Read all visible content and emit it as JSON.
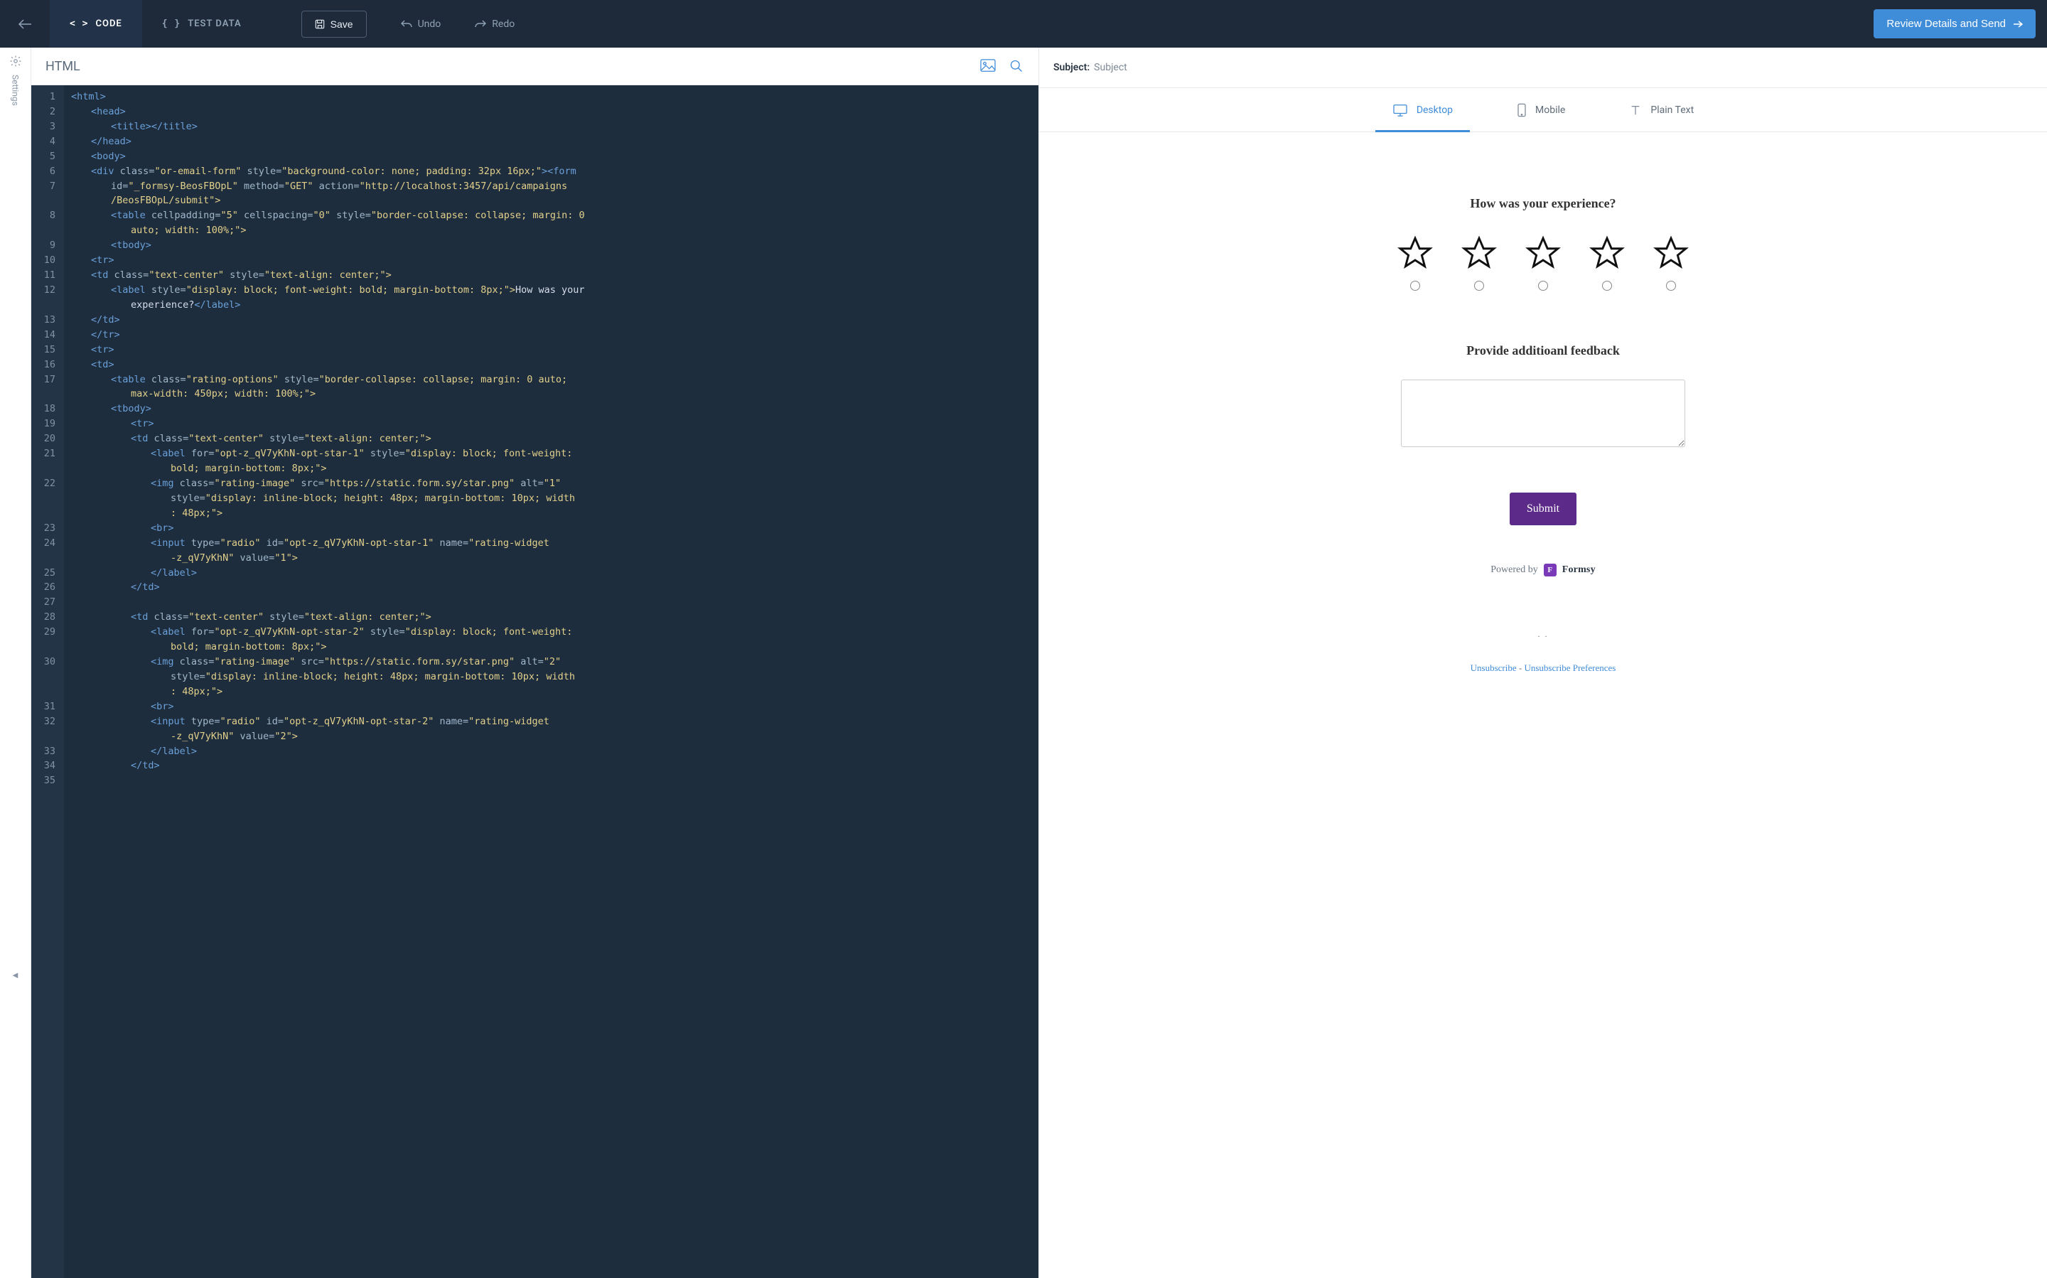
{
  "topbar": {
    "tabs": {
      "code": "CODE",
      "testdata": "TEST DATA"
    },
    "save": "Save",
    "undo": "Undo",
    "redo": "Redo",
    "review": "Review Details and Send"
  },
  "sidebar": {
    "settings": "Settings"
  },
  "editor": {
    "title": "HTML"
  },
  "code_lines": {
    "l1": "<html>",
    "l2": "<head>",
    "l3": "<title></title>",
    "l4": "</head>",
    "l5": "<body>",
    "l6_a": "<div",
    "l6_b": "class=",
    "l6_c": "\"or-email-form\"",
    "l6_d": "style=",
    "l6_e": "\"background-color: none; padding: 32px 16px;\"",
    "l6_f": "><form",
    "l7_a": "id=",
    "l7_b": "\"_formsy-BeosFBOpL\"",
    "l7_c": "method=",
    "l7_d": "\"GET\"",
    "l7_e": "action=",
    "l7_f": "\"http://localhost:3457/api/campaigns",
    "l7_g": "/BeosFBOpL/submit\">",
    "l8_a": "<table",
    "l8_b": "cellpadding=",
    "l8_c": "\"5\"",
    "l8_d": "cellspacing=",
    "l8_e": "\"0\"",
    "l8_f": "style=",
    "l8_g": "\"border-collapse: collapse; margin: 0",
    "l8_h": "auto; width: 100%;\">",
    "l9": "<tbody>",
    "l10": "<tr>",
    "l11_a": "<td",
    "l11_b": "class=",
    "l11_c": "\"text-center\"",
    "l11_d": "style=",
    "l11_e": "\"text-align: center;\">",
    "l12_a": "<label",
    "l12_b": "style=",
    "l12_c": "\"display: block; font-weight: bold; margin-bottom: 8px;\">",
    "l12_d": "How was your",
    "l12_e": "experience?",
    "l12_f": "</label>",
    "l13": "</td>",
    "l14": "</tr>",
    "l15": "<tr>",
    "l16": "<td>",
    "l17_a": "<table",
    "l17_b": "class=",
    "l17_c": "\"rating-options\"",
    "l17_d": "style=",
    "l17_e": "\"border-collapse: collapse; margin: 0 auto;",
    "l17_f": "max-width: 450px; width: 100%;\">",
    "l18": "<tbody>",
    "l19": "<tr>",
    "l20_a": "<td",
    "l20_b": "class=",
    "l20_c": "\"text-center\"",
    "l20_d": "style=",
    "l20_e": "\"text-align: center;\">",
    "l21_a": "<label",
    "l21_b": "for=",
    "l21_c": "\"opt-z_qV7yKhN-opt-star-1\"",
    "l21_d": "style=",
    "l21_e": "\"display: block; font-weight:",
    "l21_f": "bold; margin-bottom: 8px;\">",
    "l22_a": "<img",
    "l22_b": "class=",
    "l22_c": "\"rating-image\"",
    "l22_d": "src=",
    "l22_e": "\"https://static.form.sy/star.png\"",
    "l22_f": "alt=",
    "l22_g": "\"1\"",
    "l22_h": "style=",
    "l22_i": "\"display: inline-block; height: 48px; margin-bottom: 10px; width",
    "l22_j": ": 48px;\">",
    "l23": "<br>",
    "l24_a": "<input",
    "l24_b": "type=",
    "l24_c": "\"radio\"",
    "l24_d": "id=",
    "l24_e": "\"opt-z_qV7yKhN-opt-star-1\"",
    "l24_f": "name=",
    "l24_g": "\"rating-widget",
    "l24_h": "-z_qV7yKhN\"",
    "l24_i": "value=",
    "l24_j": "\"1\">",
    "l25": "</label>",
    "l26": "</td>",
    "l27": "",
    "l28_a": "<td",
    "l28_b": "class=",
    "l28_c": "\"text-center\"",
    "l28_d": "style=",
    "l28_e": "\"text-align: center;\">",
    "l29_a": "<label",
    "l29_b": "for=",
    "l29_c": "\"opt-z_qV7yKhN-opt-star-2\"",
    "l29_d": "style=",
    "l29_e": "\"display: block; font-weight:",
    "l29_f": "bold; margin-bottom: 8px;\">",
    "l30_a": "<img",
    "l30_b": "class=",
    "l30_c": "\"rating-image\"",
    "l30_d": "src=",
    "l30_e": "\"https://static.form.sy/star.png\"",
    "l30_f": "alt=",
    "l30_g": "\"2\"",
    "l30_h": "style=",
    "l30_i": "\"display: inline-block; height: 48px; margin-bottom: 10px; width",
    "l30_j": ": 48px;\">",
    "l31": "<br>",
    "l32_a": "<input",
    "l32_b": "type=",
    "l32_c": "\"radio\"",
    "l32_d": "id=",
    "l32_e": "\"opt-z_qV7yKhN-opt-star-2\"",
    "l32_f": "name=",
    "l32_g": "\"rating-widget",
    "l32_h": "-z_qV7yKhN\"",
    "l32_i": "value=",
    "l32_j": "\"2\">",
    "l33": "</label>",
    "l34": "</td>",
    "l35": ""
  },
  "gutter": [
    "1",
    "2",
    "3",
    "4",
    "5",
    "6",
    "7",
    "",
    "8",
    "",
    "9",
    "10",
    "11",
    "12",
    "",
    "13",
    "14",
    "15",
    "16",
    "17",
    "",
    "18",
    "19",
    "20",
    "21",
    "",
    "22",
    "",
    "",
    "23",
    "24",
    "",
    "25",
    "26",
    "27",
    "28",
    "29",
    "",
    "30",
    "",
    "",
    "31",
    "32",
    "",
    "33",
    "34",
    "35"
  ],
  "preview": {
    "subject_label": "Subject:",
    "subject_value": "Subject",
    "devices": {
      "desktop": "Desktop",
      "mobile": "Mobile",
      "plain": "Plain Text"
    },
    "q1": "How was your experience?",
    "q2": "Provide additioanl feedback",
    "submit": "Submit",
    "powered": "Powered by",
    "brand": "Formsy",
    "tiny": ". .",
    "unsub": "Unsubscribe",
    "unsub_sep": " - ",
    "unsub_pref": "Unsubscribe Preferences"
  }
}
